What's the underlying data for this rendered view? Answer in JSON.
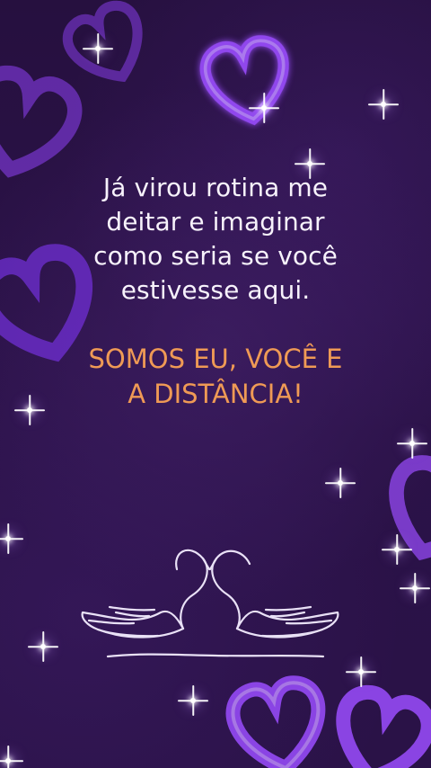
{
  "content": {
    "message": "Já virou rotina me\ndeitar e imaginar\ncomo seria se você\nestivesse aqui.",
    "highlight": "SOMOS EU, VOCÊ E\nA DISTÂNCIA!"
  },
  "colors": {
    "background": "#2b1248",
    "message_text": "#f7f2fb",
    "highlight_text": "#ef9a55",
    "heart_glow": "#8f41f5",
    "sparkle": "#ffffff",
    "swan_stroke": "#f3ecff"
  },
  "icons": {
    "hearts": "heart-icon",
    "sparkles": "sparkle-icon",
    "swans": "swan-pair-icon"
  }
}
